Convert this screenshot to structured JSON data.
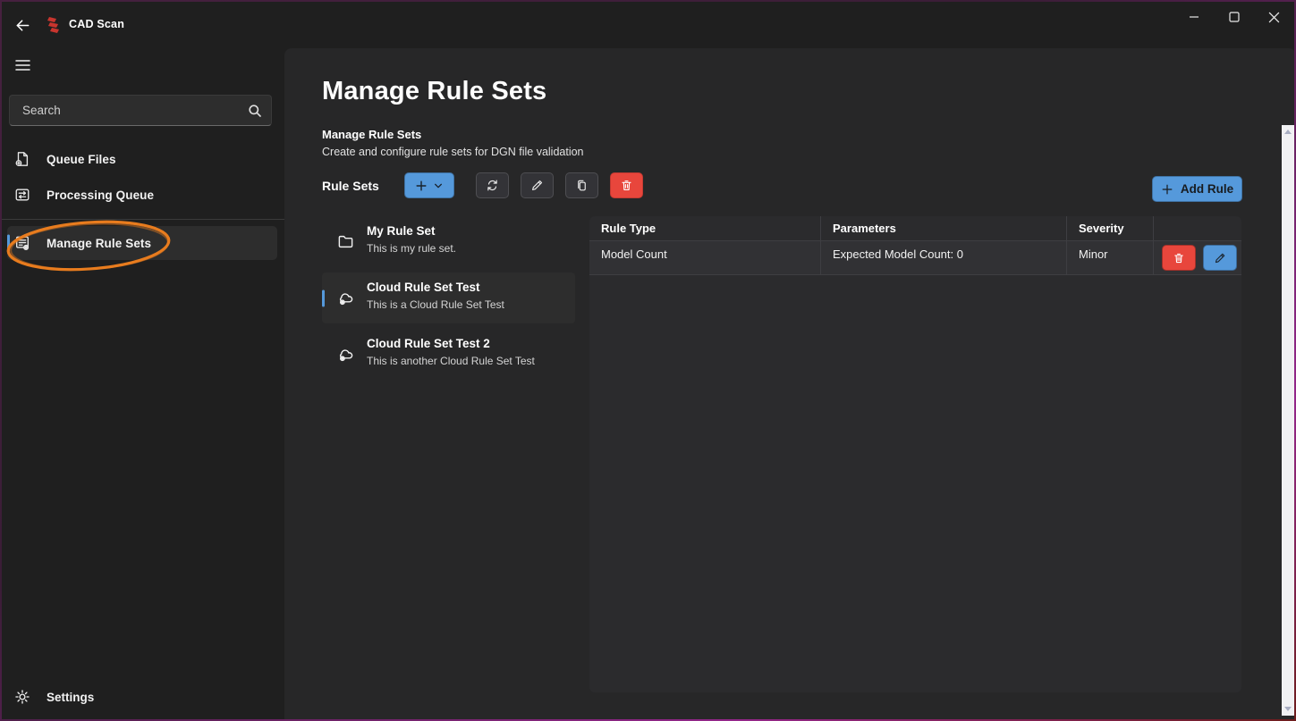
{
  "titlebar": {
    "app_title": "CAD Scan"
  },
  "window_controls": {
    "minimize": "minimize",
    "maximize": "maximize",
    "close": "close"
  },
  "sidebar": {
    "search_placeholder": "Search",
    "items": [
      {
        "label": "Queue Files",
        "icon": "queue-files-icon",
        "selected": false
      },
      {
        "label": "Processing Queue",
        "icon": "processing-queue-icon",
        "selected": false
      },
      {
        "label": "Manage Rule Sets",
        "icon": "rule-sets-icon",
        "selected": true
      }
    ],
    "settings_label": "Settings",
    "annotation": {
      "shape": "ellipse",
      "target": "Manage Rule Sets",
      "color": "#e87c1e"
    }
  },
  "main": {
    "title": "Manage Rule Sets",
    "section_title": "Manage Rule Sets",
    "section_subtitle": "Create and configure rule sets for DGN file validation",
    "rule_sets_label": "Rule Sets",
    "add_rule_label": "Add Rule",
    "toolbar_icons": [
      "add-dropdown",
      "refresh",
      "edit",
      "copy",
      "delete"
    ],
    "rule_sets": [
      {
        "name": "My Rule Set",
        "description": "This is my rule set.",
        "icon": "folder-icon",
        "selected": false
      },
      {
        "name": "Cloud Rule Set Test",
        "description": "This is a Cloud Rule Set Test",
        "icon": "cloud-gear-icon",
        "selected": true
      },
      {
        "name": "Cloud Rule Set Test 2",
        "description": "This is another Cloud Rule Set Test",
        "icon": "cloud-gear-icon",
        "selected": false
      }
    ],
    "table": {
      "columns": [
        "Rule Type",
        "Parameters",
        "Severity",
        ""
      ],
      "rows": [
        {
          "rule_type": "Model Count",
          "parameters": "Expected Model Count: 0",
          "severity": "Minor"
        }
      ]
    }
  },
  "colors": {
    "accent_blue": "#5599db",
    "danger_red": "#e8463c",
    "annotation_orange": "#e87c1e",
    "logo_red": "#c8352e"
  }
}
